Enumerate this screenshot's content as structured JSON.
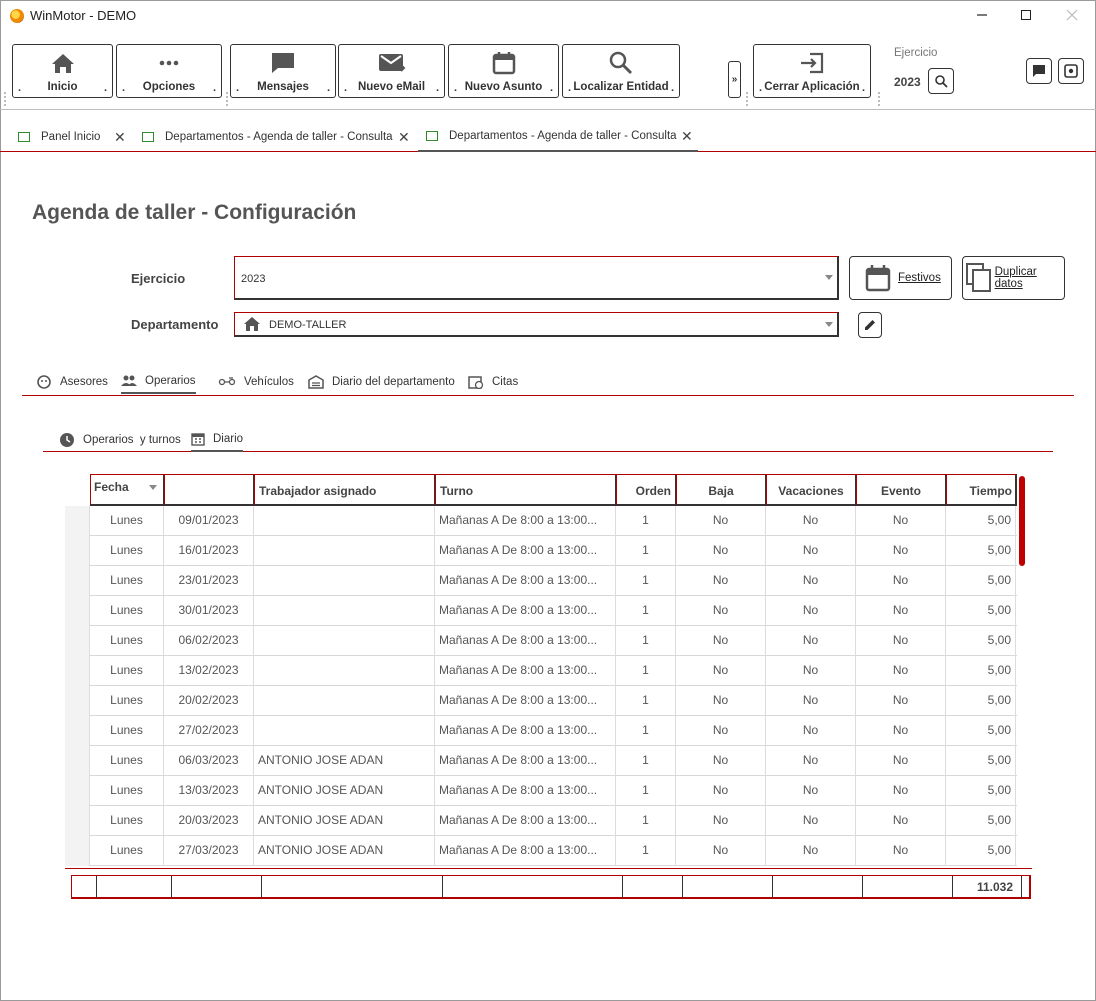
{
  "window": {
    "title": "WinMotor - DEMO"
  },
  "ribbon": {
    "buttons": [
      {
        "label": "Inicio",
        "icon": "home-icon"
      },
      {
        "label": "Opciones",
        "icon": "more-icon"
      },
      {
        "label": "Mensajes",
        "icon": "message-icon"
      },
      {
        "label": "Nuevo eMail",
        "icon": "mail-send-icon"
      },
      {
        "label": "Nuevo Asunto",
        "icon": "calendar-icon"
      },
      {
        "label": "Localizar Entidad",
        "icon": "search-icon"
      },
      {
        "label": "Cerrar Aplicación",
        "icon": "exit-icon"
      }
    ],
    "dot": ".",
    "expander": "»",
    "ejercicio_label": "Ejercicio",
    "ejercicio_value": "2023"
  },
  "tabs": [
    {
      "label": "Panel Inicio"
    },
    {
      "label": "Departamentos - Agenda de taller - Consulta"
    },
    {
      "label": "Departamentos - Agenda de taller - Consulta"
    }
  ],
  "page": {
    "title": "Agenda de taller - Configuración",
    "ejercicio_label": "Ejercicio",
    "ejercicio_value": "2023",
    "departamento_label": "Departamento",
    "departamento_value": "DEMO-TALLER",
    "festivos_label": "Festivos",
    "duplicar_label": "Duplicar datos"
  },
  "section_tabs": [
    {
      "label": "Asesores",
      "icon": "face-icon"
    },
    {
      "label": "Operarios",
      "icon": "people-icon"
    },
    {
      "label": "Vehículos",
      "icon": "car-icon"
    },
    {
      "label": "Diario del departamento",
      "icon": "warehouse-icon"
    },
    {
      "label": "Citas",
      "icon": "calendar-clock-icon"
    }
  ],
  "sub_tabs": [
    {
      "label": "Operarios  y turnos",
      "icon": "clock-icon"
    },
    {
      "label": "Diario",
      "icon": "calendar-icon"
    }
  ],
  "grid": {
    "headers": [
      "Fecha",
      "",
      "Trabajador asignado",
      "Turno",
      "Orden",
      "Baja",
      "Vacaciones",
      "Evento",
      "Tiempo"
    ],
    "rows": [
      [
        "Lunes",
        "09/01/2023",
        "",
        "Mañanas A De 8:00 a 13:00...",
        "1",
        "No",
        "No",
        "No",
        "5,00"
      ],
      [
        "Lunes",
        "16/01/2023",
        "",
        "Mañanas A De 8:00 a 13:00...",
        "1",
        "No",
        "No",
        "No",
        "5,00"
      ],
      [
        "Lunes",
        "23/01/2023",
        "",
        "Mañanas A De 8:00 a 13:00...",
        "1",
        "No",
        "No",
        "No",
        "5,00"
      ],
      [
        "Lunes",
        "30/01/2023",
        "",
        "Mañanas A De 8:00 a 13:00...",
        "1",
        "No",
        "No",
        "No",
        "5,00"
      ],
      [
        "Lunes",
        "06/02/2023",
        "",
        "Mañanas A De 8:00 a 13:00...",
        "1",
        "No",
        "No",
        "No",
        "5,00"
      ],
      [
        "Lunes",
        "13/02/2023",
        "",
        "Mañanas A De 8:00 a 13:00...",
        "1",
        "No",
        "No",
        "No",
        "5,00"
      ],
      [
        "Lunes",
        "20/02/2023",
        "",
        "Mañanas A De 8:00 a 13:00...",
        "1",
        "No",
        "No",
        "No",
        "5,00"
      ],
      [
        "Lunes",
        "27/02/2023",
        "",
        "Mañanas A De 8:00 a 13:00...",
        "1",
        "No",
        "No",
        "No",
        "5,00"
      ],
      [
        "Lunes",
        "06/03/2023",
        "ANTONIO JOSE ADAN",
        "Mañanas A De 8:00 a 13:00...",
        "1",
        "No",
        "No",
        "No",
        "5,00"
      ],
      [
        "Lunes",
        "13/03/2023",
        "ANTONIO JOSE ADAN",
        "Mañanas A De 8:00 a 13:00...",
        "1",
        "No",
        "No",
        "No",
        "5,00"
      ],
      [
        "Lunes",
        "20/03/2023",
        "ANTONIO JOSE ADAN",
        "Mañanas A De 8:00 a 13:00...",
        "1",
        "No",
        "No",
        "No",
        "5,00"
      ],
      [
        "Lunes",
        "27/03/2023",
        "ANTONIO JOSE ADAN",
        "Mañanas A De 8:00 a 13:00...",
        "1",
        "No",
        "No",
        "No",
        "5,00"
      ]
    ],
    "total": "11.032"
  },
  "colors": {
    "accent": "#b00000",
    "tab_icon": "#2e8b2e"
  }
}
